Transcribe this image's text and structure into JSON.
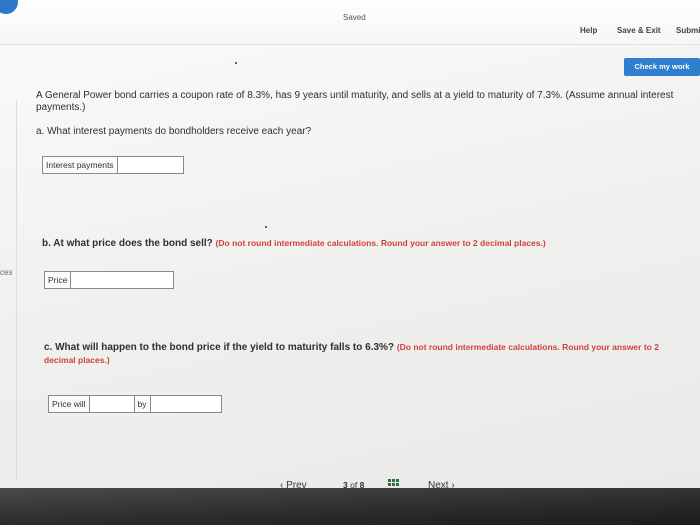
{
  "header": {
    "status": "Saved",
    "links": {
      "help": "Help",
      "save_exit": "Save & Exit",
      "submit": "Submit"
    },
    "check_button": "Check my work"
  },
  "sidebar_stub": "ces",
  "question": {
    "intro": "A General Power bond carries a coupon rate of 8.3%, has 9 years until maturity, and sells at a yield to maturity of 7.3%. (Assume annual interest payments.)",
    "part_a": {
      "prompt": "a. What interest payments do bondholders receive each year?",
      "field_label": "Interest payments",
      "value": ""
    },
    "part_b": {
      "prompt": "b. At what price does the bond sell?",
      "instruction": "(Do not round intermediate calculations. Round your answer to 2 decimal places.)",
      "field_label": "Price",
      "value": ""
    },
    "part_c": {
      "prompt": "c. What will happen to the bond price if the yield to maturity falls to 6.3%?",
      "instruction": "(Do not round intermediate calculations. Round your answer to 2 decimal places.)",
      "field_label": "Price will",
      "by_label": "by",
      "select_value": "",
      "value": ""
    }
  },
  "navigation": {
    "prev_label": "Prev",
    "page_current": "3",
    "page_of": "of",
    "page_total": "8",
    "next_label": "Next"
  },
  "colors": {
    "accent": "#2f7fcf",
    "instruction_red": "#d23f3a"
  },
  "icons": [
    "info-icon",
    "chevron-left-icon",
    "grid-icon",
    "chevron-right-icon"
  ]
}
